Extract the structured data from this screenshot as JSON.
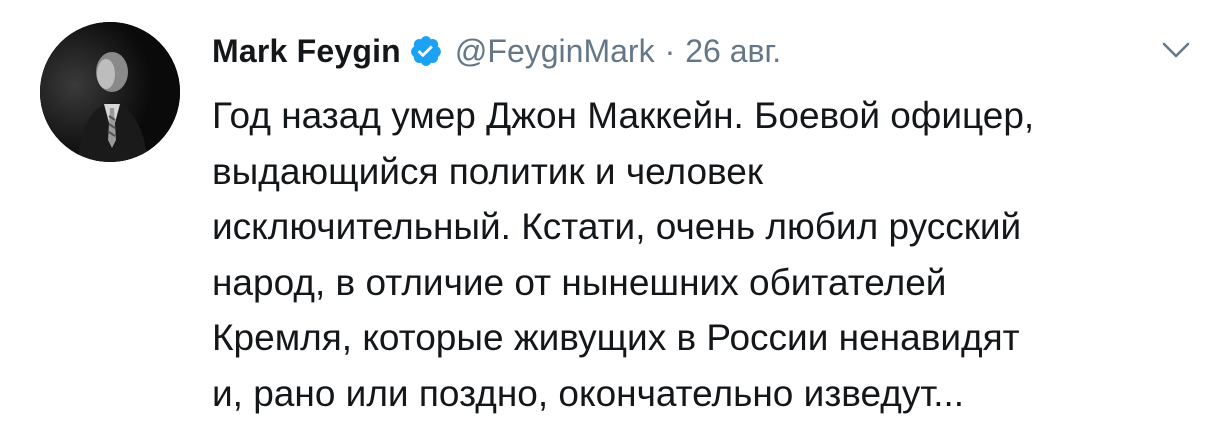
{
  "tweet": {
    "author_name": "Mark Feygin",
    "handle": "@FeyginMark",
    "separator": "·",
    "timestamp": "26 авг.",
    "verified": true,
    "avatar_icon": "profile-photo",
    "menu_icon": "chevron-down-icon",
    "text": "Год назад умер Джон Маккейн. Боевой офицер,\nвыдающийся политик и человек\nисключительный. Кстати, очень любил русский\nнарод, в отличие от нынешних обитателей\nКремля, которые живущих в России ненавидят\nи, рано или поздно, окончательно изведут..."
  },
  "colors": {
    "text_primary": "#14171a",
    "text_secondary": "#657786",
    "verified_blue": "#1da1f2",
    "background": "#ffffff"
  }
}
